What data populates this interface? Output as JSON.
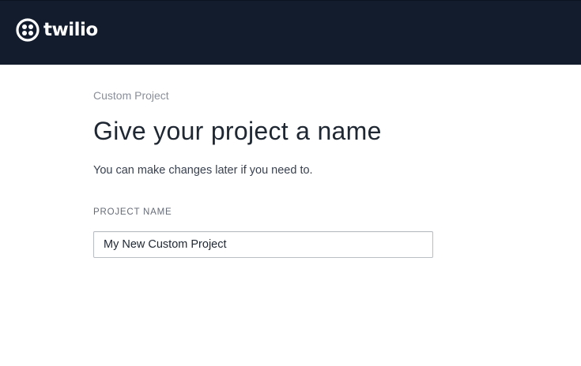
{
  "header": {
    "brand": "twilio",
    "logo_icon": "twilio-logo-icon",
    "background": "#121c2d"
  },
  "main": {
    "breadcrumb": "Custom Project",
    "title": "Give your project a name",
    "subtitle": "You can make changes later if you need to.",
    "project_name_field": {
      "label": "PROJECT NAME",
      "value": "My New Custom Project"
    }
  }
}
